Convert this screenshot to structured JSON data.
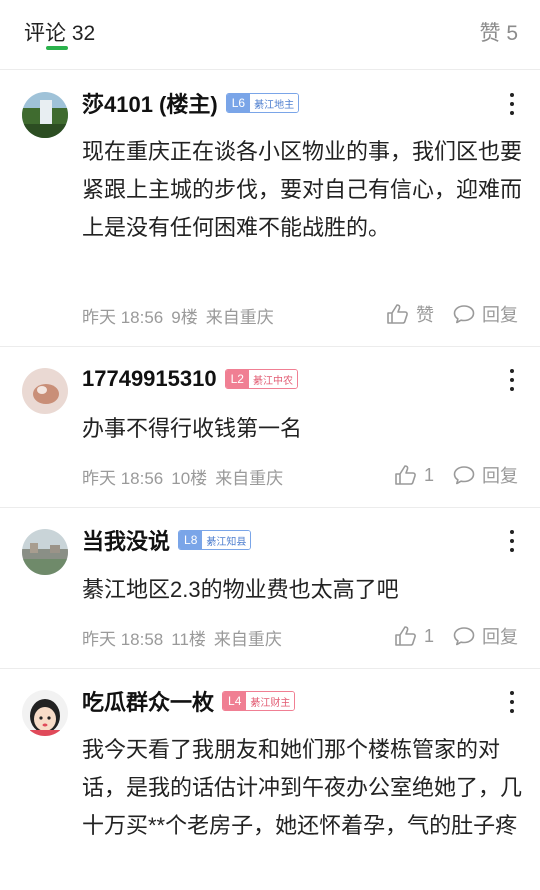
{
  "header": {
    "comments_tab": "评论 32",
    "likes_label": "赞 5"
  },
  "comments": [
    {
      "username": "莎4101 (楼主)",
      "badge_level": "L6",
      "badge_title": "綦江地主",
      "badge_color": "blue",
      "text": "现在重庆正在谈各小区物业的事，我们区也要紧跟上主城的步伐，要对自己有信心，迎难而上是没有任何困难不能战胜的。",
      "time": "昨天 18:56",
      "floor": "9楼",
      "source": "来自重庆",
      "like_label": "赞",
      "reply_label": "回复"
    },
    {
      "username": "17749915310",
      "badge_level": "L2",
      "badge_title": "綦江中农",
      "badge_color": "pink",
      "text": "办事不得行收钱第一名",
      "time": "昨天 18:56",
      "floor": "10楼",
      "source": "来自重庆",
      "like_label": "1",
      "reply_label": "回复"
    },
    {
      "username": "当我没说",
      "badge_level": "L8",
      "badge_title": "綦江知县",
      "badge_color": "blue",
      "text": "綦江地区2.3的物业费也太高了吧",
      "time": "昨天 18:58",
      "floor": "11楼",
      "source": "来自重庆",
      "like_label": "1",
      "reply_label": "回复"
    },
    {
      "username": "吃瓜群众一枚",
      "badge_level": "L4",
      "badge_title": "綦江财主",
      "badge_color": "pink",
      "text": "我今天看了我朋友和她们那个楼栋管家的对话，是我的话估计冲到午夜办公室绝她了，几十万买**个老房子，她还怀着孕，气的肚子疼"
    }
  ]
}
